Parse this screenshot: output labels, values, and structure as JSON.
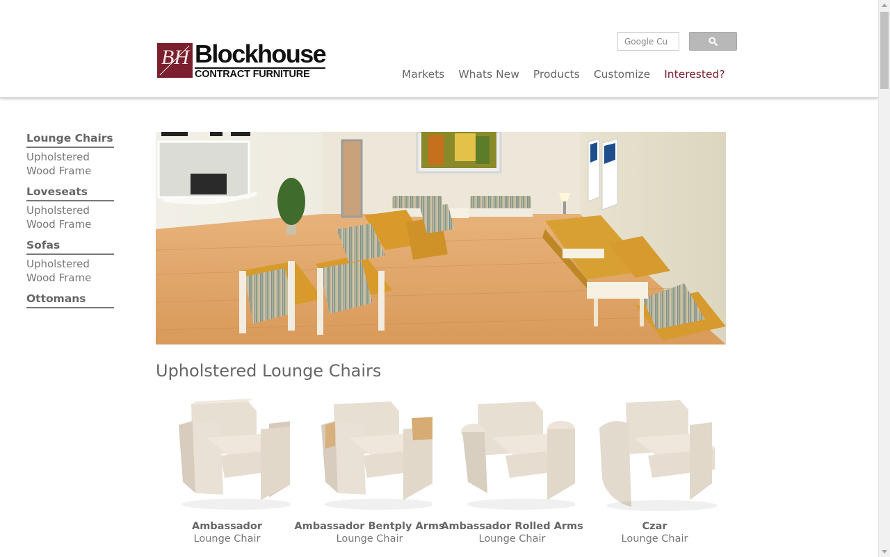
{
  "brand": {
    "name": "Blockhouse",
    "tagline": "CONTRACT FURNITURE",
    "monogram": "BH",
    "color": "#7b1f2e"
  },
  "search": {
    "placeholder": "Google Cu",
    "button_icon": "search-icon"
  },
  "nav": {
    "items": [
      {
        "label": "Markets"
      },
      {
        "label": "Whats New"
      },
      {
        "label": "Products"
      },
      {
        "label": "Customize"
      },
      {
        "label": "Interested?"
      }
    ]
  },
  "sidebar": {
    "groups": [
      {
        "heading": "Lounge Chairs",
        "links": [
          "Upholstered",
          "Wood Frame"
        ]
      },
      {
        "heading": "Loveseats",
        "links": [
          "Upholstered",
          "Wood Frame"
        ]
      },
      {
        "heading": "Sofas",
        "links": [
          "Upholstered",
          "Wood Frame"
        ]
      },
      {
        "heading": "Ottomans",
        "links": []
      }
    ]
  },
  "main": {
    "section_title": "Upholstered Lounge Chairs",
    "products": [
      {
        "name": "Ambassador",
        "type": "Lounge Chair"
      },
      {
        "name": "Ambassador Bentply Arms",
        "type": "Lounge Chair"
      },
      {
        "name": "Ambassador Rolled Arms",
        "type": "Lounge Chair"
      },
      {
        "name": "Czar",
        "type": "Lounge Chair"
      }
    ]
  }
}
